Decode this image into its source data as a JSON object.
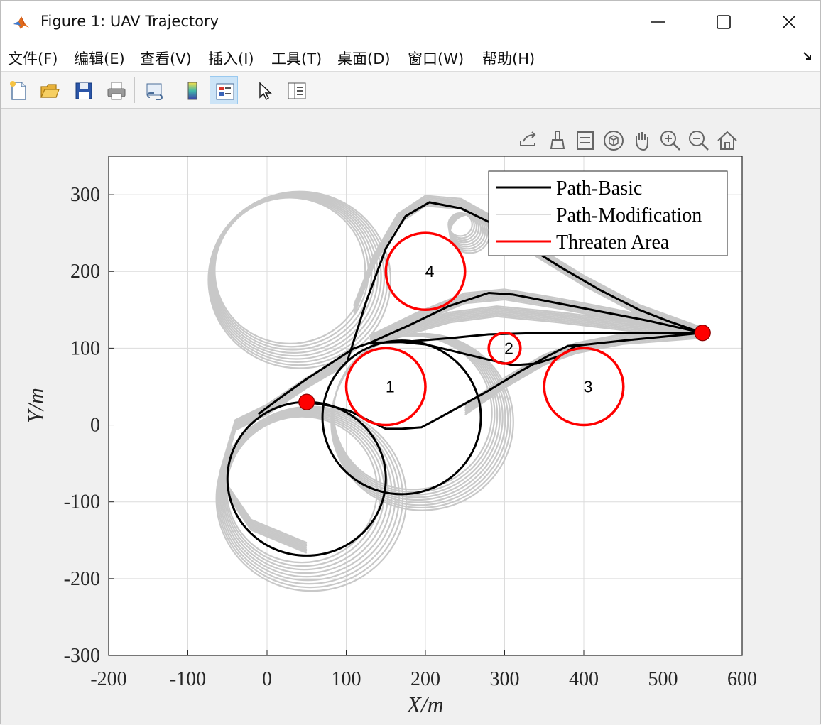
{
  "window": {
    "title": "Figure 1: UAV Trajectory",
    "minimize_icon": "minimize-icon",
    "maximize_icon": "maximize-icon",
    "close_icon": "close-icon"
  },
  "menu": {
    "items": [
      "文件(F)",
      "编辑(E)",
      "查看(V)",
      "插入(I)",
      "工具(T)",
      "桌面(D)",
      "窗口(W)",
      "帮助(H)"
    ]
  },
  "toolbar": {
    "buttons": [
      "new-figure-icon",
      "open-file-icon",
      "save-icon",
      "print-icon",
      "link-plot-icon",
      "colorbar-icon",
      "legend-icon",
      "edit-plot-icon",
      "property-inspector-icon"
    ]
  },
  "axes_toolbar": {
    "buttons": [
      "export-icon",
      "brush-icon",
      "data-tips-icon",
      "rotate-3d-icon",
      "pan-icon",
      "zoom-in-icon",
      "zoom-out-icon",
      "restore-view-icon"
    ]
  },
  "colors": {
    "basic_path": "#000000",
    "modification_path": "#c8c8c8",
    "threat": "#ff0000",
    "endpoint": "#ff0000"
  },
  "chart_data": {
    "type": "line",
    "title": "",
    "xlabel": "X/m",
    "ylabel": "Y/m",
    "xlim": [
      -200,
      600
    ],
    "ylim": [
      -300,
      350
    ],
    "xticks": [
      -200,
      -100,
      0,
      100,
      200,
      300,
      400,
      500,
      600
    ],
    "yticks": [
      -300,
      -200,
      -100,
      0,
      100,
      200,
      300
    ],
    "grid": true,
    "legend": {
      "placement": "top-right",
      "entries": [
        "Path-Basic",
        "Path-Modification",
        "Threaten Area"
      ]
    },
    "start_point": [
      50,
      30
    ],
    "end_point": [
      550,
      120
    ],
    "threats": [
      {
        "label": "1",
        "center": [
          150,
          50
        ],
        "radius": 50
      },
      {
        "label": "2",
        "center": [
          300,
          100
        ],
        "radius": 20
      },
      {
        "label": "3",
        "center": [
          400,
          50
        ],
        "radius": 50
      },
      {
        "label": "4",
        "center": [
          200,
          200
        ],
        "radius": 50
      }
    ],
    "loiter_circles_basic": [
      {
        "center": [
          50,
          -70
        ],
        "radius": 100
      },
      {
        "center": [
          170,
          10
        ],
        "radius": 100
      }
    ],
    "loiter_bands_modification": [
      {
        "center": [
          50,
          -90
        ],
        "radius_min": 95,
        "radius_max": 120
      },
      {
        "center": [
          190,
          10
        ],
        "radius_min": 100,
        "radius_max": 115
      },
      {
        "center": [
          35,
          195
        ],
        "radius_min": 95,
        "radius_max": 115
      },
      {
        "center": [
          250,
          255
        ],
        "radius_min": 15,
        "radius_max": 25
      }
    ],
    "series": [
      {
        "name": "Path-Basic",
        "paths": [
          [
            [
              50,
              30
            ],
            [
              80,
              25
            ],
            [
              105,
              18
            ],
            [
              130,
              5
            ],
            [
              150,
              -5
            ],
            [
              170,
              -5
            ],
            [
              195,
              -3
            ],
            [
              215,
              8
            ],
            [
              245,
              25
            ],
            [
              280,
              45
            ],
            [
              320,
              70
            ],
            [
              355,
              90
            ],
            [
              380,
              103
            ],
            [
              405,
              105
            ],
            [
              450,
              110
            ],
            [
              500,
              115
            ],
            [
              550,
              120
            ]
          ],
          [
            [
              -10,
              15
            ],
            [
              20,
              38
            ],
            [
              50,
              60
            ],
            [
              80,
              80
            ],
            [
              110,
              100
            ],
            [
              130,
              107
            ],
            [
              170,
              108
            ],
            [
              230,
              113
            ],
            [
              280,
              118
            ],
            [
              350,
              120
            ],
            [
              450,
              120
            ],
            [
              550,
              120
            ]
          ],
          [
            [
              170,
              108
            ],
            [
              200,
              105
            ],
            [
              240,
              95
            ],
            [
              280,
              85
            ],
            [
              310,
              78
            ],
            [
              340,
              80
            ],
            [
              370,
              90
            ],
            [
              390,
              103
            ],
            [
              405,
              105
            ]
          ],
          [
            [
              130,
              107
            ],
            [
              180,
              130
            ],
            [
              230,
              155
            ],
            [
              280,
              172
            ],
            [
              310,
              170
            ],
            [
              360,
              160
            ],
            [
              420,
              148
            ],
            [
              480,
              136
            ],
            [
              550,
              120
            ]
          ],
          [
            [
              102,
              85
            ],
            [
              125,
              160
            ],
            [
              150,
              230
            ],
            [
              175,
              272
            ],
            [
              205,
              290
            ],
            [
              245,
              282
            ],
            [
              285,
              262
            ],
            [
              320,
              238
            ],
            [
              370,
              206
            ],
            [
              420,
              176
            ],
            [
              470,
              150
            ],
            [
              510,
              134
            ],
            [
              550,
              120
            ]
          ]
        ]
      },
      {
        "name": "Path-Modification",
        "paths": [
          [
            [
              130,
              110
            ],
            [
              190,
              140
            ],
            [
              250,
              165
            ],
            [
              300,
              170
            ],
            [
              370,
              158
            ],
            [
              440,
              144
            ],
            [
              550,
              120
            ]
          ],
          [
            [
              130,
              110
            ],
            [
              180,
              125
            ],
            [
              230,
              140
            ],
            [
              290,
              148
            ],
            [
              370,
              140
            ],
            [
              450,
              130
            ],
            [
              550,
              120
            ]
          ],
          [
            [
              110,
              150
            ],
            [
              135,
              215
            ],
            [
              165,
              268
            ],
            [
              200,
              292
            ],
            [
              245,
              288
            ],
            [
              290,
              262
            ],
            [
              340,
              226
            ],
            [
              400,
              188
            ],
            [
              470,
              150
            ],
            [
              550,
              120
            ]
          ],
          [
            [
              50,
              -160
            ],
            [
              -20,
              -130
            ],
            [
              -60,
              -70
            ],
            [
              -40,
              0
            ],
            [
              0,
              20
            ],
            [
              50,
              55
            ],
            [
              100,
              85
            ]
          ],
          [
            [
              250,
              20
            ],
            [
              300,
              55
            ],
            [
              350,
              85
            ],
            [
              390,
              100
            ],
            [
              450,
              112
            ],
            [
              550,
              120
            ]
          ]
        ]
      },
      {
        "name": "Threaten Area",
        "paths": []
      }
    ]
  }
}
